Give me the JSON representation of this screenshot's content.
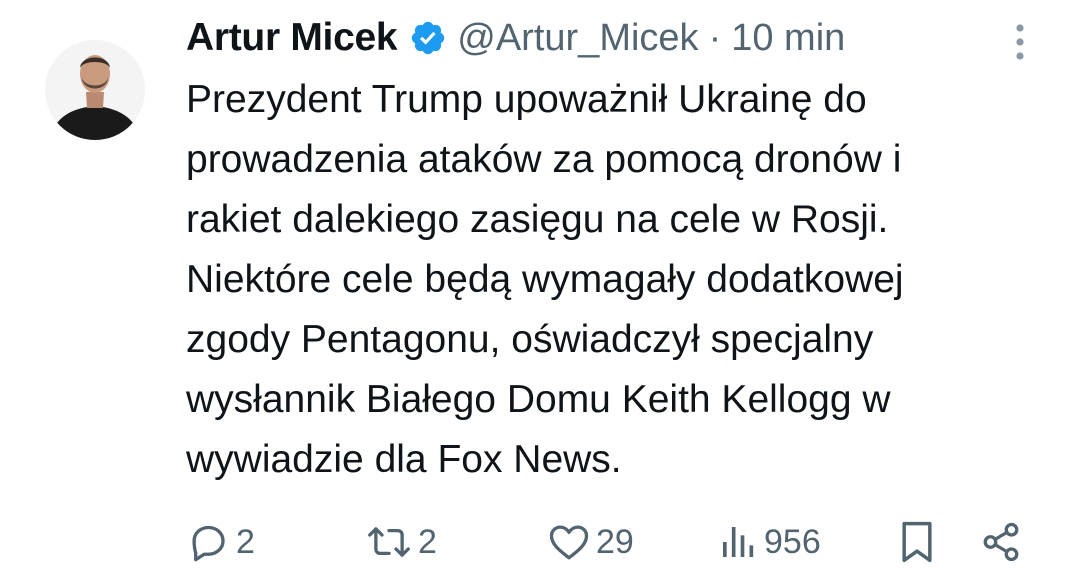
{
  "author": {
    "display_name": "Artur Micek",
    "handle": "@Artur_Micek",
    "separator": "·",
    "time": "10 min",
    "verified": true
  },
  "tweet": {
    "lines": [
      "Prezydent Trump upoważnił Ukrainę do",
      "prowadzenia ataków za pomocą dronów i",
      "rakiet dalekiego zasięgu na cele w Rosji.",
      "Niektóre cele będą wymagały dodatkowej",
      "zgody Pentagonu, oświadczył specjalny",
      "wysłannik Białego Domu Keith Kellogg w",
      "wywiadzie dla Fox News."
    ]
  },
  "actions": {
    "replies": "2",
    "reposts": "2",
    "likes": "29",
    "views": "956"
  },
  "icons": {
    "more": "more-vertical-icon",
    "reply": "reply-icon",
    "repost": "repost-icon",
    "like": "heart-icon",
    "views": "views-icon",
    "bookmark": "bookmark-icon",
    "share": "share-icon",
    "verified": "verified-badge-icon"
  },
  "colors": {
    "text": "#0f1419",
    "secondary": "#536471",
    "verified": "#1d9bf0"
  }
}
